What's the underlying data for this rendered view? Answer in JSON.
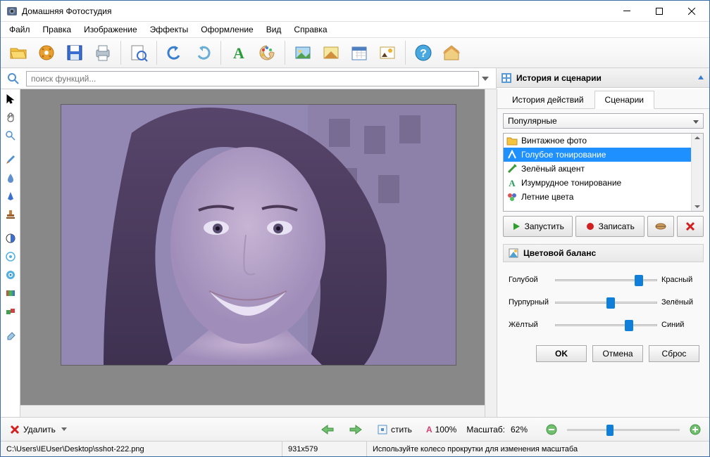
{
  "title": "Домашняя Фотостудия",
  "menu": [
    "Файл",
    "Правка",
    "Изображение",
    "Эффекты",
    "Оформление",
    "Вид",
    "Справка"
  ],
  "search": {
    "placeholder": "поиск функций..."
  },
  "right_panel": {
    "header": "История и сценарии",
    "tabs": {
      "history": "История действий",
      "scenarios": "Сценарии"
    },
    "dropdown": "Популярные",
    "scenarios": [
      "Винтажное фото",
      "Голубое тонирование",
      "Зелёный акцент",
      "Изумрудное тонирование",
      "Летние цвета"
    ],
    "actions": {
      "run": "Запустить",
      "record": "Записать"
    },
    "balance": {
      "title": "Цветовой баланс",
      "rows": [
        {
          "left": "Голубой",
          "right": "Красный",
          "value": 78
        },
        {
          "left": "Пурпурный",
          "right": "Зелёный",
          "value": 50
        },
        {
          "left": "Жёлтый",
          "right": "Синий",
          "value": 68
        }
      ]
    },
    "buttons": {
      "ok": "OK",
      "cancel": "Отмена",
      "reset": "Сброс"
    }
  },
  "bottom": {
    "delete": "Удалить",
    "fit": "стить",
    "zoom_label1": "100%",
    "zoom_caption": "Масштаб:",
    "zoom_value": "62%"
  },
  "status": {
    "path": "C:\\Users\\IEUser\\Desktop\\sshot-222.png",
    "dimensions": "931x579",
    "hint": "Используйте колесо прокрутки для изменения масштаба"
  }
}
